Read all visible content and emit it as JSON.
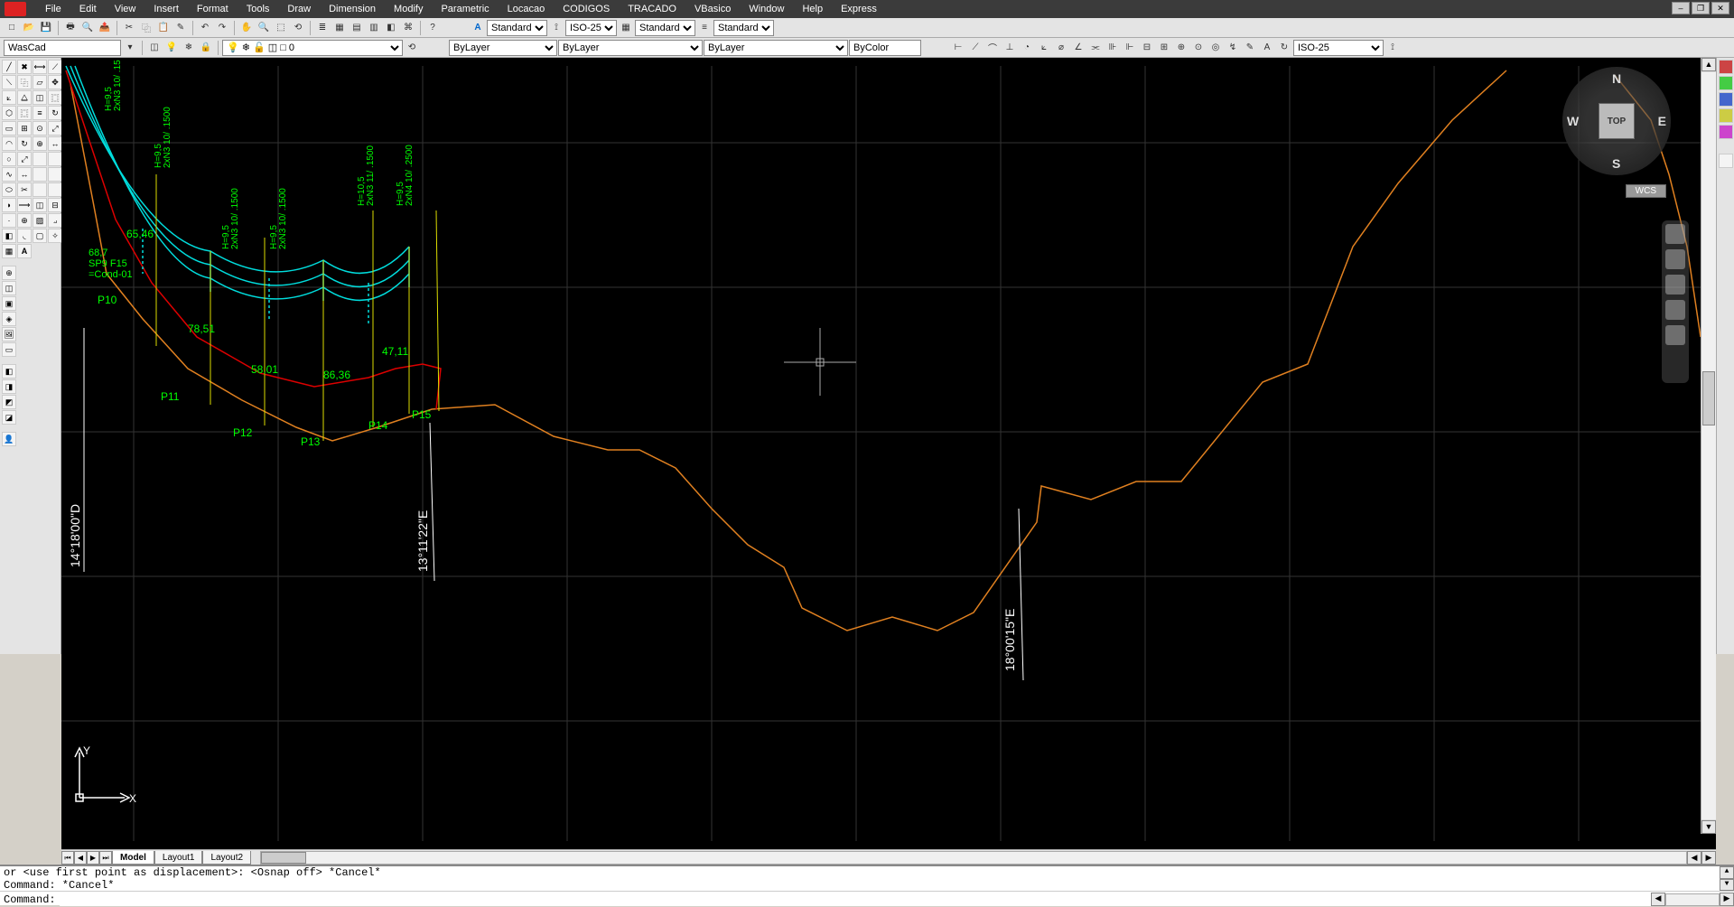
{
  "menu": [
    "File",
    "Edit",
    "View",
    "Insert",
    "Format",
    "Tools",
    "Draw",
    "Dimension",
    "Modify",
    "Parametric",
    "Locacao",
    "CODIGOS",
    "TRACADO",
    "VBasico",
    "Window",
    "Help",
    "Express"
  ],
  "style_dropdowns": {
    "text_style": "Standard",
    "dim_style": "ISO-25",
    "table_style": "Standard",
    "ml_style": "Standard"
  },
  "layer": {
    "name": "WasCad"
  },
  "props": {
    "linetype": "ByLayer",
    "lineweight": "ByLayer",
    "color": "ByColor",
    "dim_style2": "ISO-25"
  },
  "tabs": {
    "model": "Model",
    "layout1": "Layout1",
    "layout2": "Layout2"
  },
  "command": {
    "history1": "or <use first point as displacement>:  <Osnap off> *Cancel*",
    "history2": "Command: *Cancel*",
    "prompt": "Command:"
  },
  "viewcube": {
    "top": "TOP",
    "n": "N",
    "s": "S",
    "e": "E",
    "w": "W",
    "wcs": "WCS"
  },
  "drawing": {
    "points": [
      "P10",
      "P11",
      "P12",
      "P13",
      "P14",
      "P15"
    ],
    "spans": [
      "58,01",
      "86,36",
      "47,11",
      "78,51",
      "65,46"
    ],
    "anno": {
      "sp9": "SP9 F15",
      "cond": "=Cond-01",
      "val687": "68,7"
    },
    "poles": [
      {
        "h": "H=9,5",
        "n": "2xN3 10/ .1500"
      },
      {
        "h": "H=9,5",
        "n": "2xN3 10/ .1500"
      },
      {
        "h": "H=9,5",
        "n": "2xN3 10/ .1500"
      },
      {
        "h": "H=10,5",
        "n": "2xN3 11/ .1500"
      },
      {
        "h": "H=9,5",
        "n": "2xN4 10/ .2500"
      },
      {
        "h": "H=9,5",
        "n": "2xN3 10/ .15"
      }
    ],
    "coords": {
      "lat": "14°18'00\"D",
      "lon1": "13°11'22\"E",
      "lon2": "18°00'15\"E"
    },
    "axes": {
      "x": "X",
      "y": "Y"
    }
  }
}
